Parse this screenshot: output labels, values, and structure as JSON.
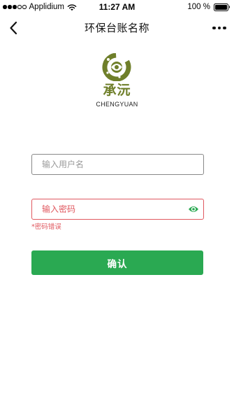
{
  "status_bar": {
    "carrier": "Applidium",
    "time": "11:27 AM",
    "battery": "100 %",
    "icons": [
      "signal-dots",
      "wifi-icon",
      "battery-icon"
    ]
  },
  "nav": {
    "title": "环保台账名称",
    "back_icon": "chevron-left-icon",
    "more_icon": "more-horizontal-icon"
  },
  "logo": {
    "name_cn": "承沅",
    "name_en": "CHENGYUAN",
    "color": "#6f7f2a"
  },
  "form": {
    "username_placeholder": "输入用户名",
    "username_value": "",
    "password_placeholder": "输入密码",
    "password_value": "",
    "password_error": "*密码错误",
    "confirm_label": "确认",
    "eye_icon": "eye-icon"
  },
  "colors": {
    "accent": "#2aa952",
    "error": "#e0585f",
    "input_border": "#888888"
  }
}
